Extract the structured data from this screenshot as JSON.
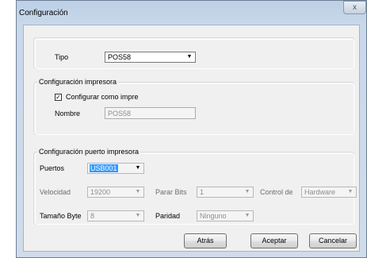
{
  "window": {
    "title": "Configuración",
    "close_glyph": "x"
  },
  "tipo": {
    "label": "Tipo",
    "value": "POS58"
  },
  "impresora": {
    "legend": "Configuración impresora",
    "checkbox_label": "Configurar como impre",
    "checked": true,
    "nombre_label": "Nombre",
    "nombre_value": "POS58"
  },
  "puerto": {
    "legend": "Configuración puerto impresora",
    "puertos_label": "Puertos",
    "puertos_value": "USB001",
    "velocidad_label": "Velocidad",
    "velocidad_value": "19200",
    "parar_bits_label": "Parar Bits",
    "parar_bits_value": "1",
    "control_label": "Control de",
    "control_value": "Hardware",
    "tamano_label": "Tamaño Byte",
    "tamano_value": "8",
    "paridad_label": "Paridad",
    "paridad_value": "Ninguno"
  },
  "buttons": {
    "atras": "Atrás",
    "aceptar": "Aceptar",
    "cancelar": "Cancelar"
  },
  "icons": {
    "dropdown": "chevron-down-icon",
    "checkmark": "checkmark-icon",
    "close": "close-icon"
  },
  "colors": {
    "title_gradient_top": "#bcd0e6",
    "client_bg": "#f0f0f0",
    "selection": "#3399ff"
  }
}
